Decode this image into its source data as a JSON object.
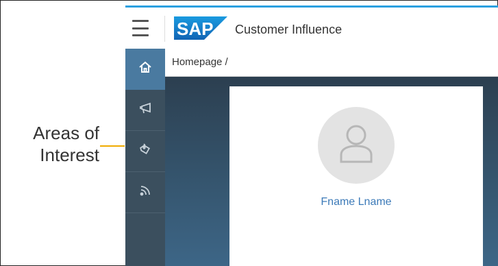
{
  "callout": {
    "text": "Areas of Interest",
    "line_color": "#f0ab00"
  },
  "shell": {
    "title": "Customer Influence",
    "logo_text": "SAP",
    "accent": "#2aa0e0"
  },
  "sidebar": {
    "items": [
      {
        "icon": "home-icon",
        "active": true
      },
      {
        "icon": "megaphone-icon",
        "active": false
      },
      {
        "icon": "tag-icon",
        "active": false
      },
      {
        "icon": "feed-icon",
        "active": false
      }
    ]
  },
  "breadcrumb": {
    "text": "Homepage /"
  },
  "profile": {
    "name": "Fname Lname",
    "avatar_icon": "person-icon"
  }
}
